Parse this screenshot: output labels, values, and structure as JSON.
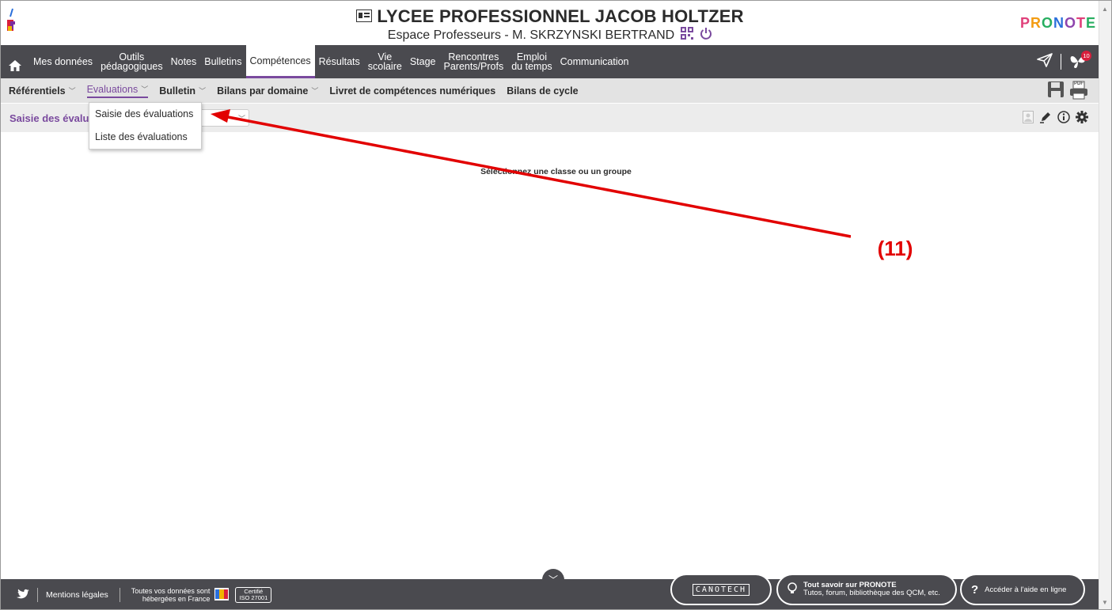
{
  "header": {
    "school_name": "LYCEE PROFESSIONNEL JACOB HOLTZER",
    "subtitle": "Espace Professeurs - M. SKRZYNSKI BERTRAND",
    "logo_text": "Jacob Holtzer",
    "brand": "PRONOTE"
  },
  "main_nav": {
    "items": [
      {
        "label": "Mes données"
      },
      {
        "label": "Outils\npédagogiques"
      },
      {
        "label": "Notes"
      },
      {
        "label": "Bulletins"
      },
      {
        "label": "Compétences"
      },
      {
        "label": "Résultats"
      },
      {
        "label": "Vie\nscolaire"
      },
      {
        "label": "Stage"
      },
      {
        "label": "Rencontres\nParents/Profs"
      },
      {
        "label": "Emploi\ndu temps"
      },
      {
        "label": "Communication"
      }
    ],
    "notification_count": "10"
  },
  "sub_nav": {
    "items": [
      {
        "label": "Référentiels"
      },
      {
        "label": "Evaluations"
      },
      {
        "label": "Bulletin"
      },
      {
        "label": "Bilans par domaine"
      },
      {
        "label": "Livret de compétences numériques"
      },
      {
        "label": "Bilans de cycle"
      }
    ],
    "pdf_label": "PDF"
  },
  "page": {
    "title": "Saisie des évalu",
    "empty_message": "Sélectionnez une classe ou un groupe"
  },
  "dropdown": {
    "items": [
      {
        "label": "Saisie des évaluations"
      },
      {
        "label": "Liste des évaluations"
      }
    ]
  },
  "annotation": {
    "label": "(11)",
    "color": "#e20000"
  },
  "footer": {
    "legal": "Mentions légales",
    "hosting_line1": "Toutes vos données sont",
    "hosting_line2": "hébergées en France",
    "cert_line1": "Certifié",
    "cert_line2": "ISO 27001",
    "canotech": "CANOTECH",
    "tout_savoir_title": "Tout savoir sur PRONOTE",
    "tout_savoir_sub": "Tutos, forum, bibliothèque des QCM, etc.",
    "aide": "Accéder à l'aide en ligne"
  },
  "colors": {
    "nav_bg": "#4a4a4f",
    "accent": "#7a4a9e",
    "subnav_bg": "#e3e3e3"
  }
}
